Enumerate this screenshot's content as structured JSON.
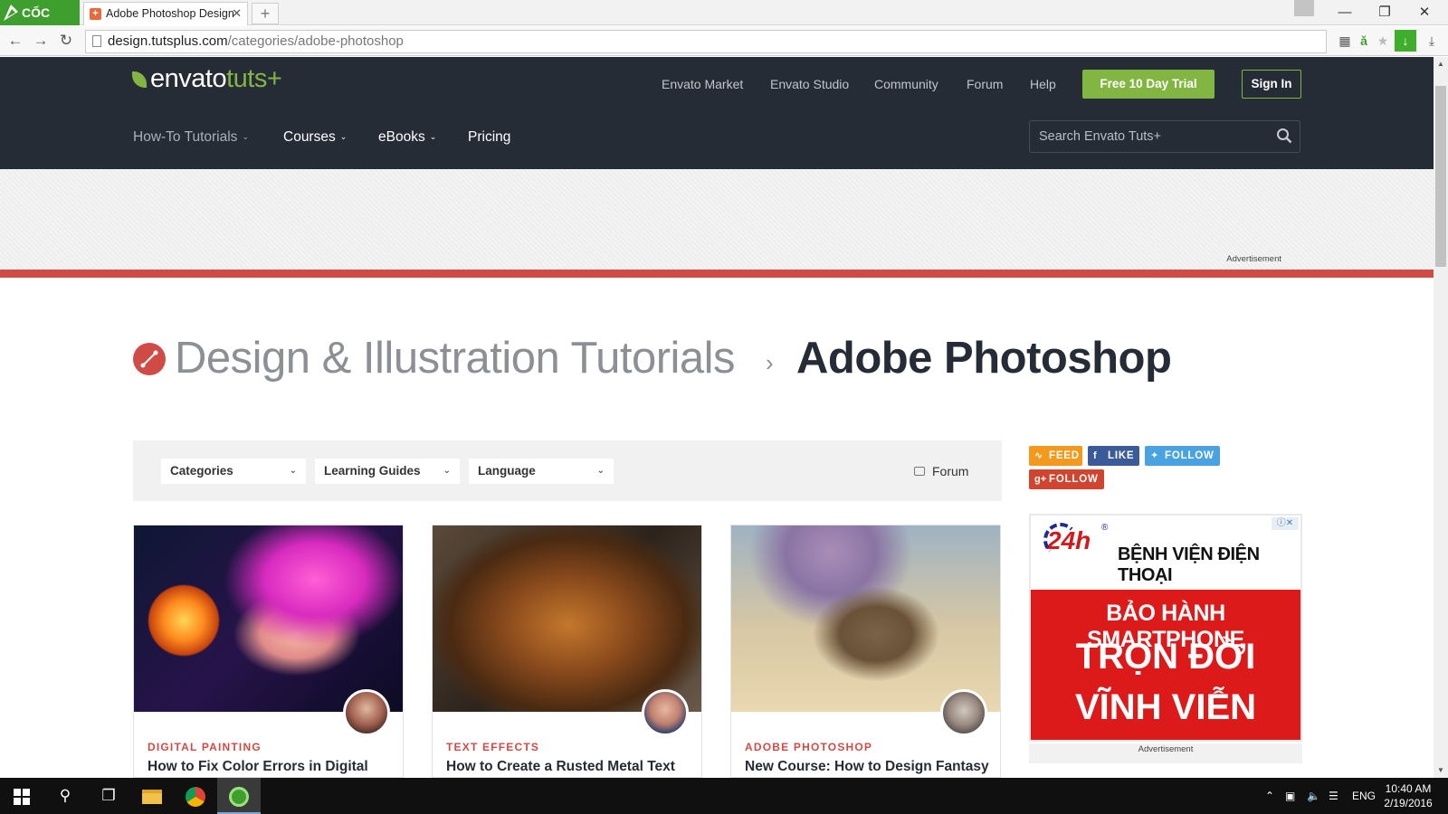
{
  "browser": {
    "brand": "CỐC CỐC",
    "tab_title": "Adobe Photoshop Design",
    "tab_close": "✕",
    "new_tab": "+",
    "url_host": "design.tutsplus.com",
    "url_path": "/categories/adobe-photoshop",
    "window_controls": {
      "minimize": "—",
      "restore": "❐",
      "close": "✕"
    }
  },
  "site": {
    "logo_main": "envato",
    "logo_tuts": "tuts+",
    "top_nav": [
      "Envato Market",
      "Envato Studio",
      "Community",
      "Forum",
      "Help"
    ],
    "trial_button": "Free 10 Day Trial",
    "signin_button": "Sign In",
    "main_nav": [
      {
        "label": "How-To Tutorials",
        "caret": "⌄"
      },
      {
        "label": "Courses",
        "caret": "⌄"
      },
      {
        "label": "eBooks",
        "caret": "⌄"
      },
      {
        "label": "Pricing",
        "caret": ""
      }
    ],
    "search_placeholder": "Search Envato Tuts+",
    "ad_label": "Advertisement"
  },
  "breadcrumb": {
    "parent": "Design & Illustration Tutorials",
    "separator": "›",
    "current": "Adobe Photoshop"
  },
  "filters": {
    "dropdowns": [
      "Categories",
      "Learning Guides",
      "Language"
    ],
    "caret": "⌄",
    "forum_link": "Forum"
  },
  "social": {
    "feed": "FEED",
    "like": "LIKE",
    "follow_twitter": "FOLLOW",
    "follow_gplus": "FOLLOW",
    "colors": {
      "feed": "#f39a1e",
      "like": "#3b5b98",
      "twitter": "#4aa3e0",
      "gplus": "#d0452f"
    }
  },
  "cards": [
    {
      "category": "DIGITAL PAINTING",
      "title": "How to Fix Color Errors in Digital"
    },
    {
      "category": "TEXT EFFECTS",
      "title": "How to Create a Rusted Metal Text"
    },
    {
      "category": "ADOBE PHOTOSHOP",
      "title": "New Course: How to Design Fantasy"
    }
  ],
  "side_ad": {
    "logo_text": "24h",
    "registered": "®",
    "brand_name": "BỆNH VIỆN ĐIỆN THOẠI",
    "line1": "BẢO HÀNH SMARTPHONE",
    "line2": "TRỌN ĐỜI",
    "line3": "VĨNH VIỄN",
    "ad_choices": "ⓘ✕",
    "label": "Advertisement"
  },
  "taskbar": {
    "language": "ENG",
    "time": "10:40 AM",
    "date": "2/19/2016"
  },
  "colors": {
    "header_bg": "#262c36",
    "brand_green": "#82b541",
    "accent_red": "#d04b46"
  }
}
